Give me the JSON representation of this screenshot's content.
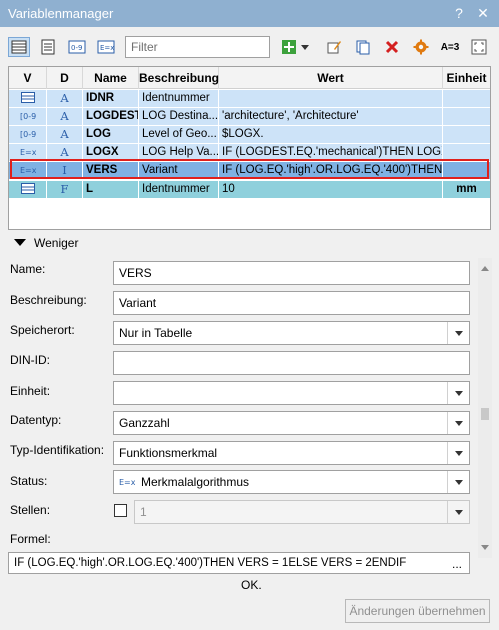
{
  "window": {
    "title": "Variablenmanager"
  },
  "toolbar": {
    "filter_placeholder": "Filter",
    "ab_label": "A=3"
  },
  "grid": {
    "columns": [
      "V",
      "D",
      "Name",
      "Beschreibung",
      "Wert",
      "Einheit"
    ],
    "rows": [
      {
        "v_icon": "table-icon",
        "d_icon": "a-type-icon",
        "d_char": "A",
        "name": "IDNR",
        "beschreibung": "Identnummer",
        "wert": "",
        "einheit": ""
      },
      {
        "v_icon": "range-icon",
        "d_icon": "a-type-icon",
        "d_char": "A",
        "name": "LOGDEST",
        "beschreibung": "LOG Destina...",
        "wert": "'architecture', 'Architecture'",
        "einheit": ""
      },
      {
        "v_icon": "range-icon",
        "d_icon": "a-type-icon",
        "d_char": "A",
        "name": "LOG",
        "beschreibung": "Level of Geo...",
        "wert": "$LOGX.",
        "einheit": ""
      },
      {
        "v_icon": "formula-icon",
        "d_icon": "a-type-icon",
        "d_char": "A",
        "name": "LOGX",
        "beschreibung": "LOG Help Va...",
        "wert": "IF (LOGDEST.EQ.'mechanical')THEN LOGX...",
        "einheit": ""
      },
      {
        "v_icon": "formula-icon",
        "d_icon": "i-type-icon",
        "d_char": "I",
        "name": "VERS",
        "beschreibung": "Variant",
        "wert": "IF (LOG.EQ.'high'.OR.LOG.EQ.'400')THEN...",
        "einheit": ""
      },
      {
        "v_icon": "table-icon",
        "d_icon": "f-type-icon",
        "d_char": "F",
        "name": "L",
        "beschreibung": "Identnummer",
        "wert": "10",
        "einheit": "mm"
      }
    ]
  },
  "details": {
    "toggle_label": "Weniger",
    "name_label": "Name:",
    "name_value": "VERS",
    "beschreibung_label": "Beschreibung:",
    "beschreibung_value": "Variant",
    "speicherort_label": "Speicherort:",
    "speicherort_value": "Nur in Tabelle",
    "din_label": "DIN-ID:",
    "din_value": "",
    "einheit_label": "Einheit:",
    "einheit_value": "",
    "datentyp_label": "Datentyp:",
    "datentyp_value": "Ganzzahl",
    "typ_label": "Typ-Identifikation:",
    "typ_value": "Funktionsmerkmal",
    "status_label": "Status:",
    "status_value": "Merkmalalgorithmus",
    "stellen_label": "Stellen:",
    "stellen_value": "1",
    "formel_label": "Formel:",
    "formel_value": "IF (LOG.EQ.'high'.OR.LOG.EQ.'400')THEN VERS = 1ELSE VERS = 2ENDIF",
    "formel_more": "..."
  },
  "footer": {
    "ok_label": "OK.",
    "apply_label": "Änderungen übernehmen"
  },
  "colors": {
    "row_bg": "#cde3f8",
    "row_selected": "#7fb1e3",
    "row_teal": "#8fd0dc",
    "highlight_frame": "#e0201c",
    "titlebar": "#8fb0d0"
  }
}
